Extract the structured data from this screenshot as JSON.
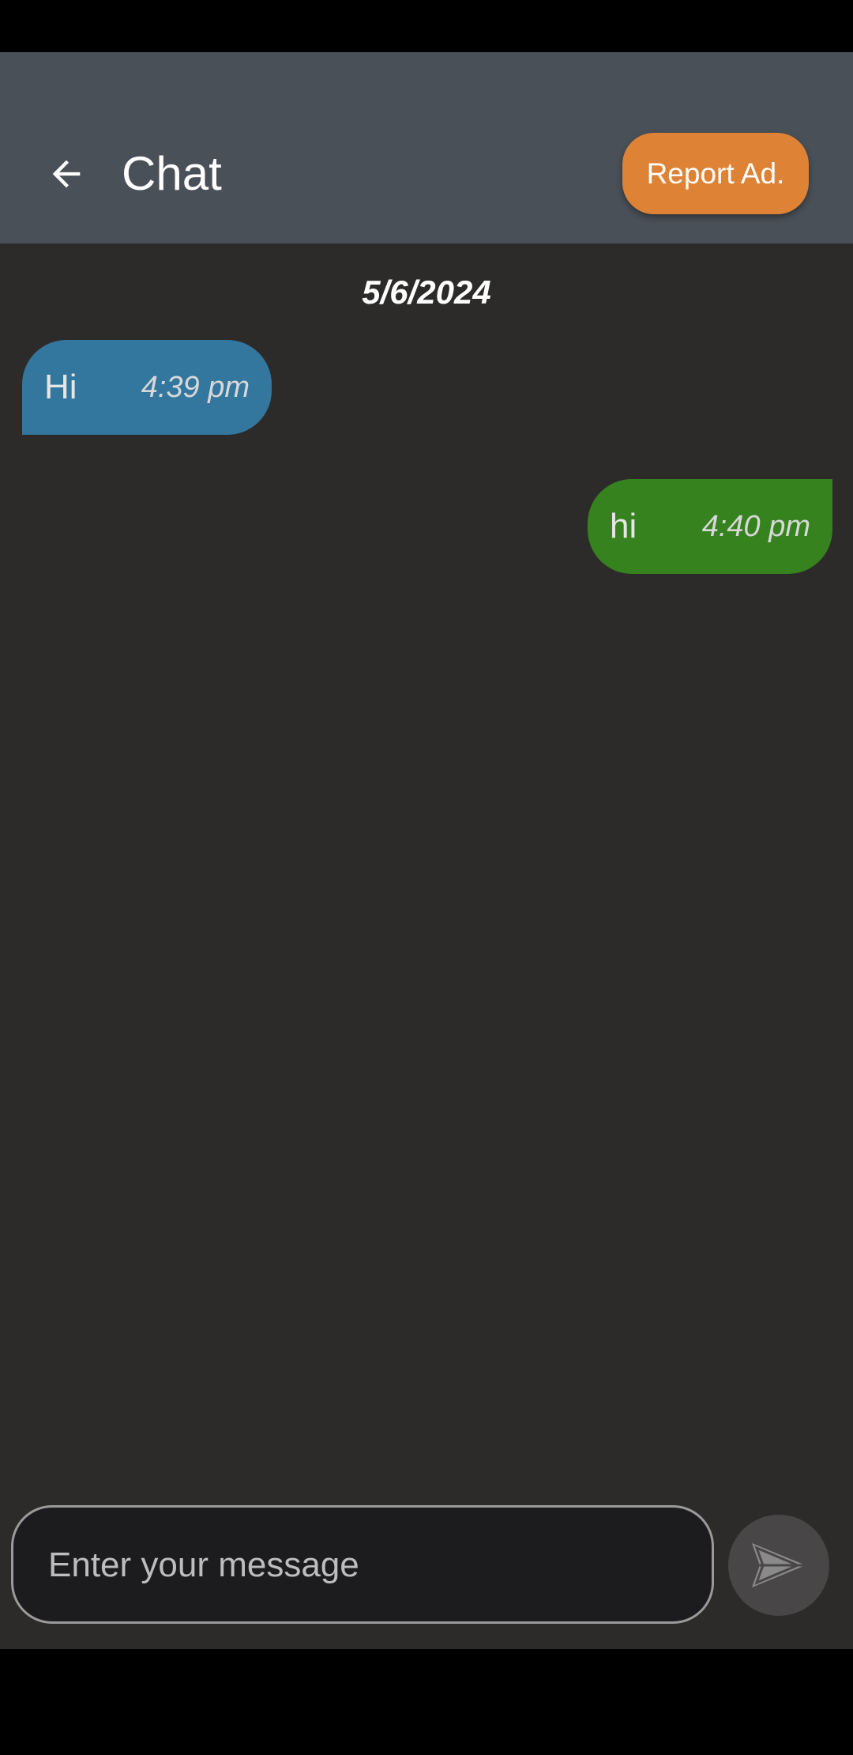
{
  "header": {
    "title": "Chat",
    "report_label": "Report Ad.",
    "back_icon": "arrow-left-icon",
    "background_color": "#4a5058",
    "report_color": "#de8235"
  },
  "conversation": {
    "date": "5/6/2024",
    "messages": [
      {
        "direction": "incoming",
        "text": "Hi",
        "time": "4:39 pm",
        "color": "#33769e"
      },
      {
        "direction": "outgoing",
        "text": "hi",
        "time": "4:40 pm",
        "color": "#35821f"
      }
    ]
  },
  "composer": {
    "placeholder": "Enter your message",
    "value": "",
    "send_icon": "send-icon"
  }
}
